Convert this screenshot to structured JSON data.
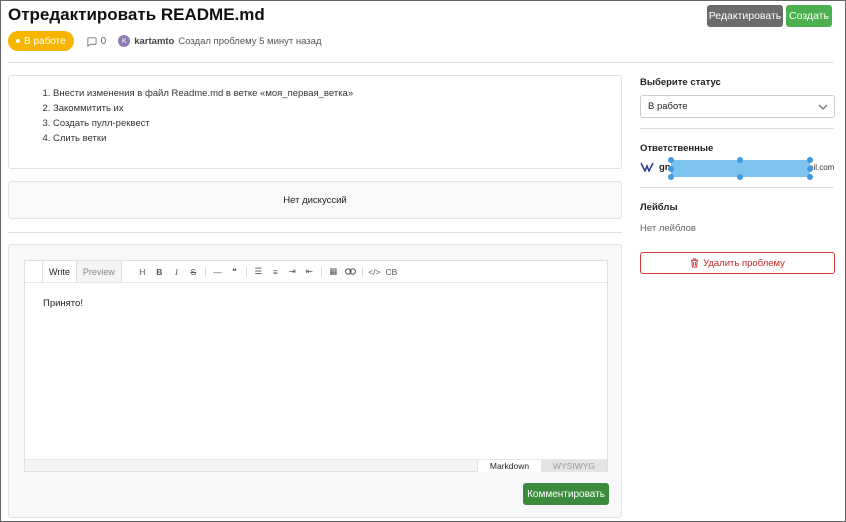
{
  "page": {
    "title": "Отредактировать README.md",
    "edit_label": "Редактировать",
    "create_label": "Создать"
  },
  "meta": {
    "status": "В работе",
    "comment_count": "0",
    "author": "kartamto",
    "author_initial": "K",
    "created_text": "Создал проблему 5 минут назад"
  },
  "description": {
    "items": [
      "Внести изменения в файл Readme.md в ветке «моя_первая_ветка»",
      "Закоммитить их",
      "Создать пулл-реквест",
      "Слить ветки"
    ]
  },
  "discussion": {
    "empty_text": "Нет дискуссий"
  },
  "editor": {
    "tab_write": "Write",
    "tab_preview": "Preview",
    "tools": [
      "H",
      "B",
      "I",
      "S",
      "—",
      "❝",
      "☰",
      "≡",
      "⇥",
      "⇤",
      "▦",
      "🔗",
      "</>",
      "CB"
    ],
    "text": "Принято!",
    "mode_markdown": "Markdown",
    "mode_wysiwyg": "WYSIWYG",
    "submit_label": "Комментировать"
  },
  "sidebar": {
    "status_label": "Выберите статус",
    "status_value": "В работе",
    "assignees_label": "Ответственные",
    "assignee_prefix": "gn",
    "assignee_suffix": "ail.com",
    "labels_label": "Лейблы",
    "labels_empty": "Нет лейблов",
    "delete_label": "Удалить проблему"
  },
  "colors": {
    "status": "#f7b500",
    "create": "#4caf50",
    "comment": "#3c8a3c",
    "danger": "#d43b3b",
    "redaction": "#7cc3ef"
  }
}
